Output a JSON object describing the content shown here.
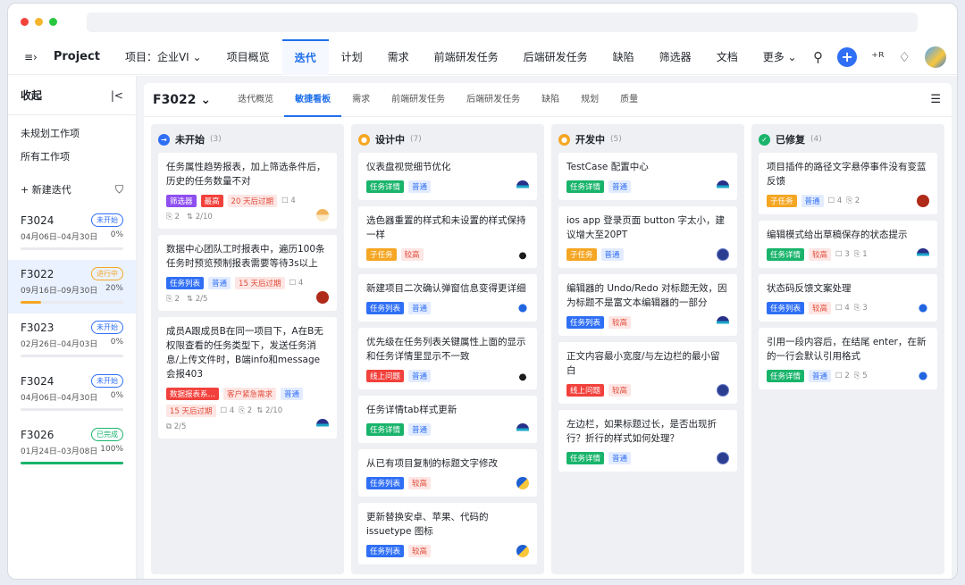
{
  "nav": {
    "menu_icon": "≡›",
    "app_name": "Project",
    "project_label": "项目：企业VI ⌄",
    "tabs": [
      "项目概览",
      "迭代",
      "计划",
      "需求",
      "前端研发任务",
      "后端研发任务",
      "缺陷",
      "筛选器",
      "文档",
      "更多 ⌄"
    ],
    "active_tab": "迭代",
    "icons": [
      "search-icon",
      "plus-icon",
      "add-user-icon",
      "bell-icon",
      "avatar"
    ]
  },
  "sidebar": {
    "title": "收起",
    "collapse_icon": "|<",
    "links": [
      "未规划工作项",
      "所有工作项"
    ],
    "new_label": "+ 新建迭代",
    "iterations": [
      {
        "name": "F3024",
        "status": "未开始",
        "range": "04月06日–04月30日",
        "percent": "0%",
        "progress": 0,
        "color": "#2f6ff5"
      },
      {
        "name": "F3022",
        "status": "进行中",
        "range": "09月16日–09月30日",
        "percent": "20%",
        "progress": 0.2,
        "color": "#f5a623"
      },
      {
        "name": "F3023",
        "status": "未开始",
        "range": "02月26日–04月03日",
        "percent": "0%",
        "progress": 0,
        "color": "#2f6ff5"
      },
      {
        "name": "F3024",
        "status": "未开始",
        "range": "04月06日–04月30日",
        "percent": "0%",
        "progress": 0,
        "color": "#2f6ff5"
      },
      {
        "name": "F3026",
        "status": "已完成",
        "range": "01月24日–03月08日",
        "percent": "100%",
        "progress": 1,
        "color": "#19b46b"
      }
    ]
  },
  "content": {
    "sprint": "F3022 ⌄",
    "tabs": [
      "迭代概览",
      "敏捷看板",
      "需求",
      "前端研发任务",
      "后端研发任务",
      "缺陷",
      "规划",
      "质量"
    ],
    "active_tab": "敏捷看板"
  },
  "columns": [
    {
      "title": "未开始",
      "count": "(3)",
      "icon_color": "#2f6ff5",
      "icon": "→",
      "cards": [
        {
          "title": "任务属性趋势报表，加上筛选条件后，历史的任务数量不对",
          "tags": [
            [
              "筛选器",
              "#8e4ef0",
              "#fff"
            ],
            [
              "最高",
              "#f2413c",
              "#fff"
            ],
            [
              "20 天后过期",
              "#fde6e4",
              "#e34d3b"
            ]
          ],
          "meta": [
            "☐ 4"
          ],
          "meta2": [
            "⎘ 2",
            "⇅ 2/10"
          ],
          "av": "av7"
        },
        {
          "title": "数据中心团队工时报表中，遍历100条任务时预览预制报表需要等待3s以上",
          "tags": [
            [
              "任务列表",
              "#2f6ff5",
              "#fff"
            ],
            [
              "普通",
              "#e3ecff",
              "#2f6ff5"
            ],
            [
              "15 天后过期",
              "#fde6e4",
              "#e34d3b"
            ]
          ],
          "meta": [
            "☐ 4"
          ],
          "meta2": [
            "⎘ 2",
            "⇅ 2/5"
          ],
          "av": "av3"
        },
        {
          "title": "成员A跟成员B在同一项目下，A在B无权限查看的任务类型下，发送任务消息/上传文件时，B端info和message会报403",
          "tags": [
            [
              "数据报表系…",
              "#f2413c",
              "#fff"
            ],
            [
              "客户紧急需求",
              "#fde6e4",
              "#e34d3b"
            ],
            [
              "普通",
              "#e3ecff",
              "#2f6ff5"
            ]
          ],
          "meta": [
            "15 天后过期",
            "☐ 4",
            "⎘ 2",
            "⇅ 2/10"
          ],
          "meta2": [
            "⧉ 2/5"
          ],
          "av": "av1"
        }
      ]
    },
    {
      "title": "设计中",
      "count": "(7)",
      "icon_color": "#f5a623",
      "icon": "●",
      "cards": [
        {
          "title": "仪表盘视觉细节优化",
          "tags": [
            [
              "任务详情",
              "#19b46b",
              "#fff"
            ],
            [
              "普通",
              "#e3ecff",
              "#2f6ff5"
            ]
          ],
          "av": "av1"
        },
        {
          "title": "选色器重置的样式和未设置的样式保持一样",
          "tags": [
            [
              "子任务",
              "#f5a623",
              "#fff"
            ],
            [
              "较高",
              "#fde6e4",
              "#e34d3b"
            ]
          ],
          "av": "av2"
        },
        {
          "title": "新建项目二次确认弹窗信息变得更详细",
          "tags": [
            [
              "任务列表",
              "#2f6ff5",
              "#fff"
            ],
            [
              "普通",
              "#e3ecff",
              "#2f6ff5"
            ]
          ],
          "av": "av6"
        },
        {
          "title": "优先级在任务列表关键属性上面的显示和任务详情里显示不一致",
          "tags": [
            [
              "线上问题",
              "#f2413c",
              "#fff"
            ],
            [
              "普通",
              "#e3ecff",
              "#2f6ff5"
            ]
          ],
          "av": "av2"
        },
        {
          "title": "任务详情tab样式更新",
          "tags": [
            [
              "任务详情",
              "#19b46b",
              "#fff"
            ],
            [
              "普通",
              "#e3ecff",
              "#2f6ff5"
            ]
          ],
          "av": "av1"
        },
        {
          "title": "从已有项目复制的标题文字修改",
          "tags": [
            [
              "任务列表",
              "#2f6ff5",
              "#fff"
            ],
            [
              "较高",
              "#fde6e4",
              "#e34d3b"
            ]
          ],
          "av": "av5"
        },
        {
          "title": "更新替换安卓、苹果、代码的issuetype 图标",
          "tags": [
            [
              "任务列表",
              "#2f6ff5",
              "#fff"
            ],
            [
              "较高",
              "#fde6e4",
              "#e34d3b"
            ]
          ],
          "av": "av5"
        }
      ]
    },
    {
      "title": "开发中",
      "count": "(5)",
      "icon_color": "#f5a623",
      "icon": "●",
      "cards": [
        {
          "title": "TestCase 配置中心",
          "tags": [
            [
              "任务详情",
              "#19b46b",
              "#fff"
            ],
            [
              "普通",
              "#e3ecff",
              "#2f6ff5"
            ]
          ],
          "av": "av1"
        },
        {
          "title": "ios app 登录页面 button 字太小，建议增大至20PT",
          "tags": [
            [
              "子任务",
              "#f5a623",
              "#fff"
            ],
            [
              "普通",
              "#e3ecff",
              "#2f6ff5"
            ]
          ],
          "av": "av4"
        },
        {
          "title": "编辑器的 Undo/Redo 对标题无效，因为标题不是富文本编辑器的一部分",
          "tags": [
            [
              "任务列表",
              "#2f6ff5",
              "#fff"
            ],
            [
              "较高",
              "#fde6e4",
              "#e34d3b"
            ]
          ],
          "av": "av1"
        },
        {
          "title": "正文内容最小宽度/与左边栏的最小留白",
          "tags": [
            [
              "线上问题",
              "#f2413c",
              "#fff"
            ],
            [
              "较高",
              "#fde6e4",
              "#e34d3b"
            ]
          ],
          "av": "av4"
        },
        {
          "title": "左边栏，如果标题过长，是否出现折行？折行的样式如何处理？",
          "tags": [
            [
              "任务详情",
              "#19b46b",
              "#fff"
            ],
            [
              "普通",
              "#e3ecff",
              "#2f6ff5"
            ]
          ],
          "av": "av4"
        }
      ]
    },
    {
      "title": "已修复",
      "count": "(4)",
      "icon_color": "#19b46b",
      "icon": "✓",
      "cards": [
        {
          "title": "项目插件的路径文字悬停事件没有变蓝反馈",
          "tags": [
            [
              "子任务",
              "#f5a623",
              "#fff"
            ],
            [
              "普通",
              "#e3ecff",
              "#2f6ff5"
            ]
          ],
          "meta_inline": [
            "☐ 4",
            "⎘ 2"
          ],
          "av": "av3"
        },
        {
          "title": "编辑模式给出草稿保存的状态提示",
          "tags": [
            [
              "任务详情",
              "#19b46b",
              "#fff"
            ],
            [
              "较高",
              "#fde6e4",
              "#e34d3b"
            ]
          ],
          "meta_inline": [
            "☐ 3",
            "⎘ 1"
          ],
          "av": "av1"
        },
        {
          "title": "状态码反馈文案处理",
          "tags": [
            [
              "任务列表",
              "#2f6ff5",
              "#fff"
            ],
            [
              "较高",
              "#fde6e4",
              "#e34d3b"
            ]
          ],
          "meta_inline": [
            "☐ 4",
            "⎘ 3"
          ],
          "av": "av6"
        },
        {
          "title": "引用一段内容后，在结尾 enter，在新的一行会默认引用格式",
          "tags": [
            [
              "任务详情",
              "#19b46b",
              "#fff"
            ],
            [
              "普通",
              "#e3ecff",
              "#2f6ff5"
            ]
          ],
          "meta_inline": [
            "☐ 2",
            "⎘ 5"
          ],
          "av": "av6"
        }
      ]
    }
  ]
}
